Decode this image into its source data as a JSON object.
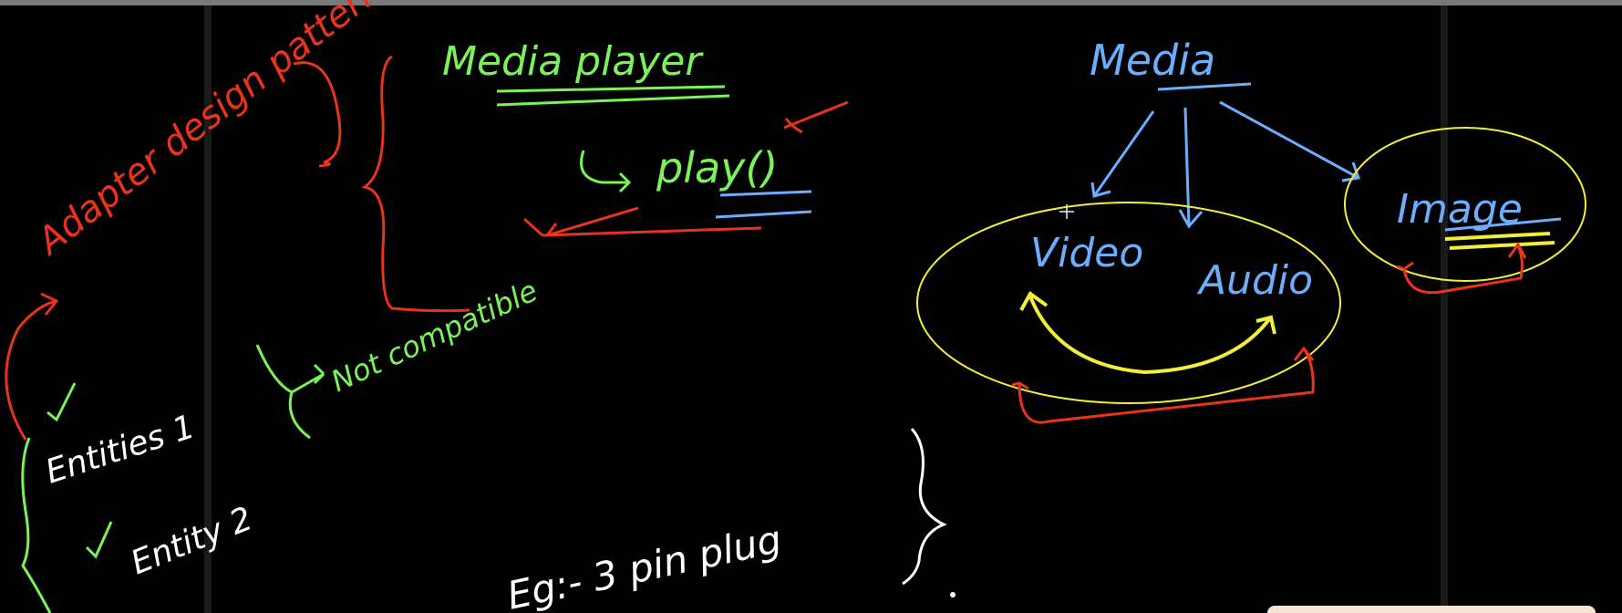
{
  "whiteboard": {
    "colors": {
      "red": "#e8341c",
      "green": "#7cf25a",
      "blue": "#6aaefc",
      "yellow": "#f2ee3a",
      "white": "#ffffff",
      "background": "#000000"
    },
    "left_section": {
      "title": "Adapter design pattern",
      "entity_one": "Entities 1",
      "entity_two": "Entity 2",
      "not_compatible": "Not compatible",
      "example": "Eg:- 3 pin plug"
    },
    "middle_section": {
      "media_player": "Media player",
      "play_method": "play()"
    },
    "right_section": {
      "media": "Media",
      "video": "Video",
      "audio": "Audio",
      "image": "Image"
    }
  }
}
